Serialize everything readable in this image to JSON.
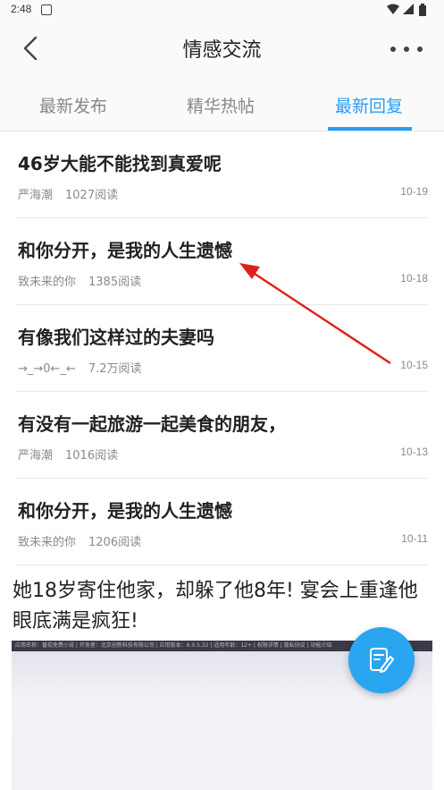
{
  "status": {
    "time": "2:48"
  },
  "header": {
    "title": "情感交流"
  },
  "tabs": [
    {
      "label": "最新发布"
    },
    {
      "label": "精华热帖"
    },
    {
      "label": "最新回复"
    }
  ],
  "active_tab": "最新回复",
  "posts": [
    {
      "title": "46岁大能不能找到真爱呢",
      "author": "严海潮",
      "views": "1027阅读",
      "date": "10-19"
    },
    {
      "title": "和你分开，是我的人生遗憾",
      "author": "致未来的你",
      "views": "1385阅读",
      "date": "10-18"
    },
    {
      "title": "有像我们这样过的夫妻吗",
      "author": "→_→0←_←",
      "views": "7.2万阅读",
      "date": "10-15"
    },
    {
      "title": "有没有一起旅游一起美食的朋友，",
      "author": "严海潮",
      "views": "1016阅读",
      "date": "10-13"
    },
    {
      "title": "和你分开，是我的人生遗憾",
      "author": "致未来的你",
      "views": "1206阅读",
      "date": "10-11"
    }
  ],
  "ad": {
    "title": "她18岁寄住他家，却躲了他8年! 宴会上重逢他眼底满是疯狂!",
    "info": "应用名称：番茄免费小说 | 开发者：北京创新科技有限公司 | 应用版本：6.0.5.32 | 适用年龄：12+ | 权限详情 | 隐私协议 | 功能介绍"
  },
  "colors": {
    "accent": "#2a9df4",
    "fab": "#2aa6f0",
    "annotation": "#e0201c"
  },
  "icons": {
    "back": "chevron-left-icon",
    "more": "more-horizontal-icon",
    "fab": "edit-note-icon"
  }
}
